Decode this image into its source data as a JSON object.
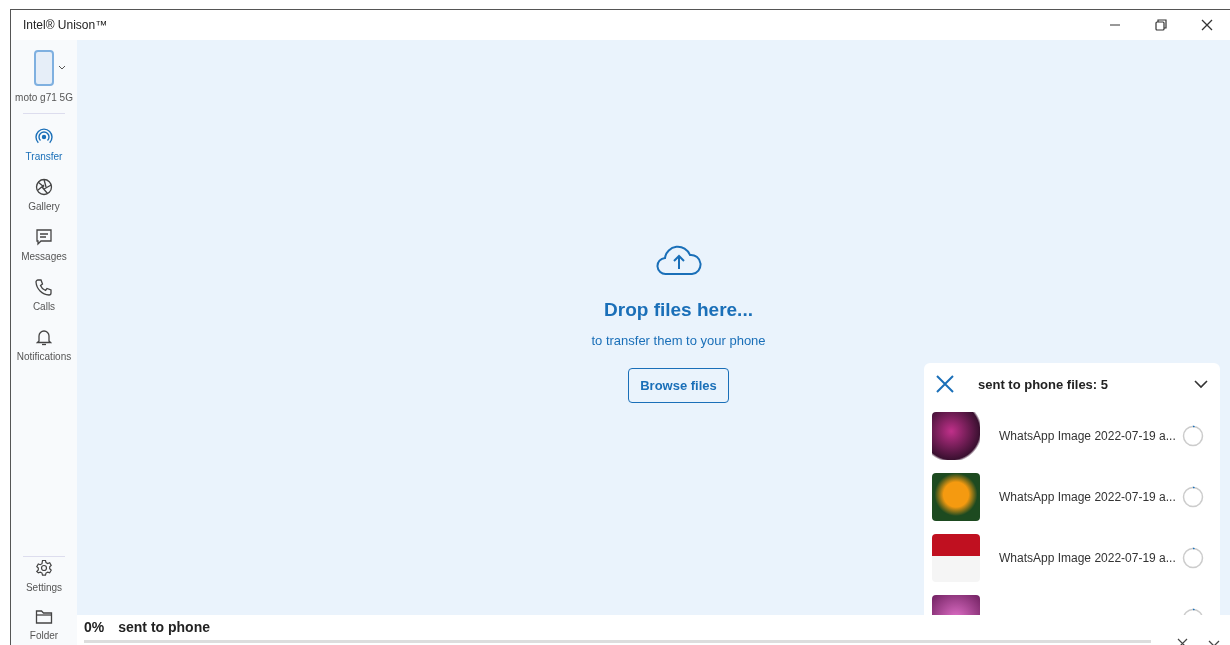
{
  "window": {
    "title": "Intel® Unison™"
  },
  "device": {
    "name": "moto g71 5G"
  },
  "sidebar": {
    "items": [
      {
        "label": "Transfer",
        "selected": true
      },
      {
        "label": "Gallery",
        "selected": false
      },
      {
        "label": "Messages",
        "selected": false
      },
      {
        "label": "Calls",
        "selected": false
      },
      {
        "label": "Notifications",
        "selected": false
      }
    ],
    "bottom_items": [
      {
        "label": "Settings",
        "selected": false
      },
      {
        "label": "Folder",
        "selected": false
      }
    ]
  },
  "drop_zone": {
    "title": "Drop files here...",
    "subtitle": "to transfer them to your phone",
    "button": "Browse files"
  },
  "transfer_panel": {
    "title": "sent to phone files: 5",
    "files": [
      {
        "kind": "file",
        "name": "WhatsApp Image 2022-07-19 a..."
      },
      {
        "kind": "file",
        "name": "WhatsApp Image 2022-07-19 a..."
      },
      {
        "kind": "file",
        "name": "WhatsApp Image 2022-07-19 a..."
      },
      {
        "kind": "clipped"
      }
    ]
  },
  "status_bar": {
    "percent": "0%",
    "label": "sent to phone",
    "level": 0
  }
}
